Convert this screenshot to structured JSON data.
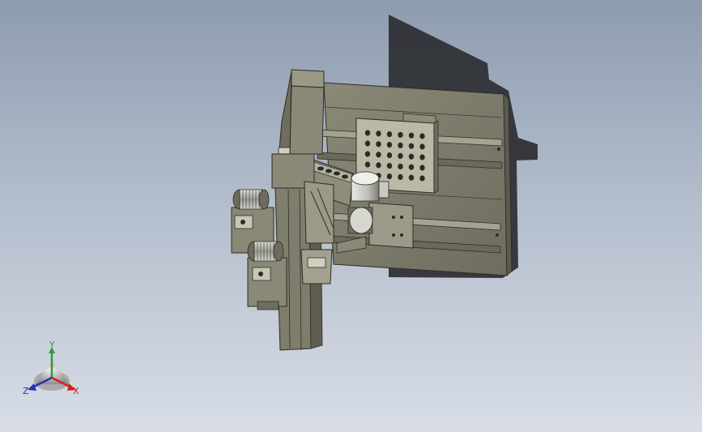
{
  "viewport": {
    "background_top": "#8e9cb0",
    "background_bottom": "#d8dde6",
    "model_color": "#7d7c6c",
    "model_edge_color": "#2c2c26",
    "shadow_color": "#2f3236"
  },
  "triad": {
    "x_label": "X",
    "y_label": "Y",
    "z_label": "Z",
    "x_color": "#d0221b",
    "y_color": "#2e9b3a",
    "z_color": "#2733b5"
  }
}
